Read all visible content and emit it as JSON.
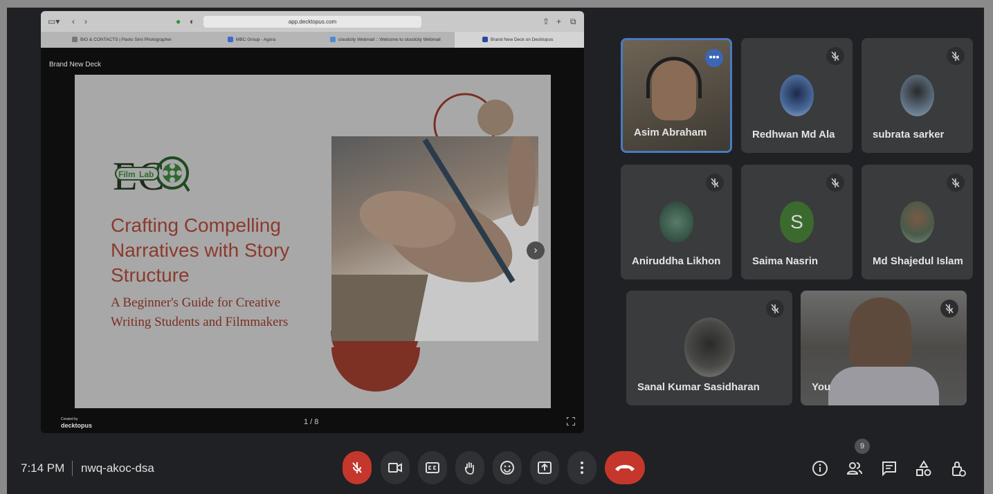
{
  "browser": {
    "address": "app.decktopus.com",
    "tabs": [
      {
        "label": "BIO & CONTACTS | Paolo Simi Photographer",
        "active": false
      },
      {
        "label": "MBC Group - Agora",
        "active": false
      },
      {
        "label": "cloudcity Webmail :: Welcome to cloudcity Webmail",
        "active": false
      },
      {
        "label": "Brand New Deck on Decktopus",
        "active": true
      }
    ]
  },
  "presentation": {
    "deck_title": "Brand New Deck",
    "logo_text": {
      "film": "Film",
      "lab": "Lab",
      "eco": "ECO"
    },
    "slide_title": "Crafting Compelling\nNarratives with Story\nStructure",
    "slide_subtitle": "A Beginner's Guide for Creative\nWriting Students and Filmmakers",
    "created_by": "Created by",
    "brand": "decktopus",
    "page": "1 / 8"
  },
  "participants": [
    {
      "name": "Asim Abraham",
      "muted": false,
      "speaking": true
    },
    {
      "name": "Redhwan Md Ala",
      "muted": true
    },
    {
      "name": "subrata sarker",
      "muted": true
    },
    {
      "name": "Aniruddha Likhon",
      "muted": true
    },
    {
      "name": "Saima Nasrin",
      "muted": true,
      "initial": "S"
    },
    {
      "name": "Md Shajedul Islam",
      "muted": true
    },
    {
      "name": "Sanal Kumar Sasidharan",
      "muted": true
    },
    {
      "name": "You",
      "muted": true
    }
  ],
  "meeting": {
    "time": "7:14 PM",
    "code": "nwq-akoc-dsa",
    "people_count": "9"
  },
  "colors": {
    "end_call": "#c5372c",
    "active_speaker_border": "#4a7ac0",
    "background": "#202124"
  },
  "icons": [
    "mic-off-icon",
    "camera-icon",
    "captions-icon",
    "raise-hand-icon",
    "emoji-icon",
    "present-icon",
    "more-options-icon",
    "end-call-icon",
    "info-icon",
    "people-icon",
    "chat-icon",
    "activities-icon",
    "host-controls-icon"
  ]
}
